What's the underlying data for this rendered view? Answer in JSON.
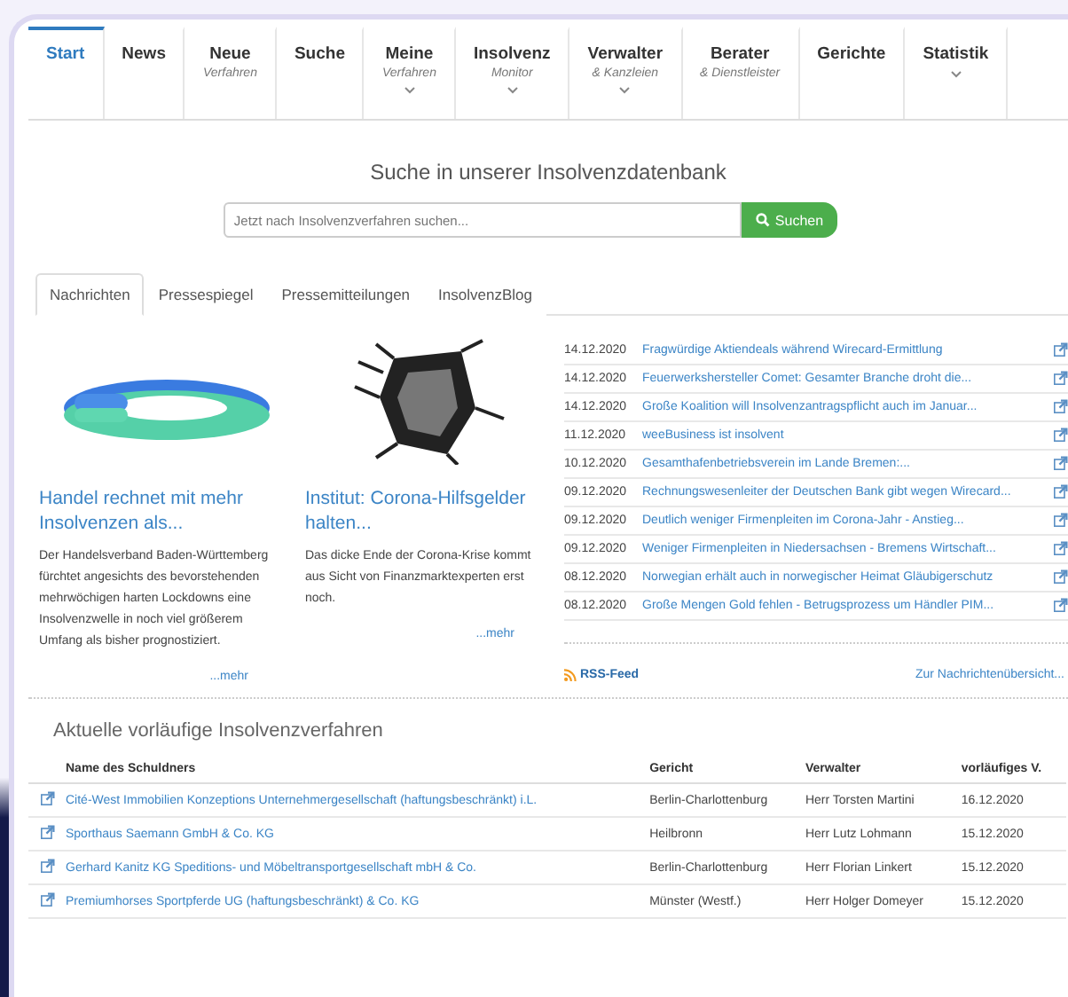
{
  "nav": [
    {
      "label": "Start",
      "selected": true
    },
    {
      "label": "News",
      "selected": false
    },
    {
      "label": "Neue",
      "sub": "Verfahren",
      "selected": false
    },
    {
      "label": "Suche",
      "selected": false
    },
    {
      "label": "Meine",
      "sub": "Verfahren",
      "dropdown": true,
      "selected": false
    },
    {
      "label": "Insolvenz",
      "sub": "Monitor",
      "dropdown": true,
      "selected": false
    },
    {
      "label": "Verwalter",
      "sub": "& Kanzleien",
      "dropdown": true,
      "selected": false
    },
    {
      "label": "Berater",
      "sub": "& Dienstleister",
      "selected": false
    },
    {
      "label": "Gerichte",
      "selected": false
    },
    {
      "label": "Statistik",
      "dropdown": true,
      "selected": false
    }
  ],
  "search": {
    "heading": "Suche in unserer Insolvenzdatenbank",
    "placeholder": "Jetzt nach Insolvenzverfahren suchen...",
    "button": "Suchen"
  },
  "news_tabs": [
    {
      "label": "Nachrichten",
      "selected": true
    },
    {
      "label": "Pressespiegel",
      "selected": false
    },
    {
      "label": "Pressemitteilungen",
      "selected": false
    },
    {
      "label": "InsolvenzBlog",
      "selected": false
    }
  ],
  "articles": [
    {
      "title": "Handel rechnet mit mehr Insolvenzen als...",
      "text": "Der Handelsverband Baden-Württemberg fürchtet angesichts des bevorstehenden mehrwöchigen harten Lockdowns eine Insolvenzwelle in noch viel größerem Umfang als bisher prognostiziert.",
      "more": "...mehr"
    },
    {
      "title": "Institut: Corona-Hilfsgelder halten...",
      "text": "Das dicke Ende der Corona-Krise kommt aus Sicht von Finanzmarktexperten erst noch.",
      "more": "...mehr"
    }
  ],
  "news": [
    {
      "date": "14.12.2020",
      "title": "Fragwürdige Aktiendeals während Wirecard-Ermittlung"
    },
    {
      "date": "14.12.2020",
      "title": "Feuerwerkshersteller Comet: Gesamter Branche droht die..."
    },
    {
      "date": "14.12.2020",
      "title": "Große Koalition will Insolvenzantragspflicht auch im Januar..."
    },
    {
      "date": "11.12.2020",
      "title": "weeBusiness ist insolvent"
    },
    {
      "date": "10.12.2020",
      "title": "Gesamthafenbetriebsverein im Lande Bremen:..."
    },
    {
      "date": "09.12.2020",
      "title": "Rechnungswesenleiter der Deutschen Bank gibt wegen Wirecard..."
    },
    {
      "date": "09.12.2020",
      "title": "Deutlich weniger Firmenpleiten im Corona-Jahr - Anstieg..."
    },
    {
      "date": "09.12.2020",
      "title": "Weniger Firmenpleiten in Niedersachsen - Bremens Wirtschaft..."
    },
    {
      "date": "08.12.2020",
      "title": "Norwegian erhält auch in norwegischer Heimat Gläubigerschutz"
    },
    {
      "date": "08.12.2020",
      "title": "Große Mengen Gold fehlen - Betrugsprozess um Händler PIM..."
    }
  ],
  "rss": "RSS-Feed",
  "overview": "Zur Nachrichtenübersicht...",
  "table": {
    "title": "Aktuelle vorläufige Insolvenzverfahren",
    "columns": [
      "Name des Schuldners",
      "Gericht",
      "Verwalter",
      "vorläufiges V."
    ],
    "rows": [
      [
        "Cité-West Immobilien Konzeptions Unternehmergesellschaft (haftungsbeschränkt) i.L.",
        "Berlin-Charlottenburg",
        "Herr Torsten Martini",
        "16.12.2020"
      ],
      [
        "Sporthaus Saemann GmbH & Co. KG",
        "Heilbronn",
        "Herr Lutz Lohmann",
        "15.12.2020"
      ],
      [
        "Gerhard Kanitz KG Speditions- und Möbeltransportgesellschaft mbH & Co.",
        "Berlin-Charlottenburg",
        "Herr Florian Linkert",
        "15.12.2020"
      ],
      [
        "Premiumhorses Sportpferde UG (haftungsbeschränkt) & Co. KG",
        "Münster (Westf.)",
        "Herr Holger Domeyer",
        "15.12.2020"
      ]
    ]
  }
}
